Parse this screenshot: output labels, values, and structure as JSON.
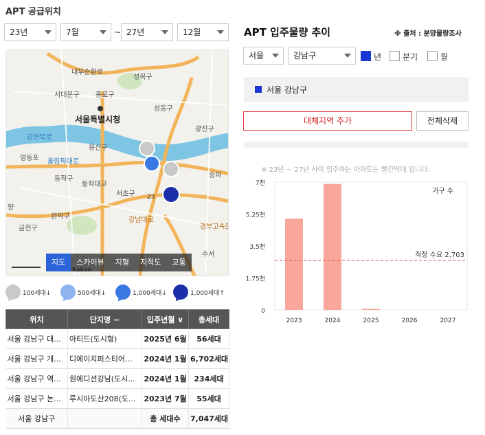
{
  "left": {
    "section_title": "APT 공급위치",
    "filters": {
      "start_year": "23년",
      "start_month": "7월",
      "range_sep": "~",
      "end_year": "27년",
      "end_month": "12월"
    },
    "map": {
      "labels": [
        "서울특별시청",
        "내부순환로",
        "성북구",
        "서대문구",
        "종로구",
        "성동구",
        "광진구",
        "강변북로",
        "올림픽대로",
        "용산구",
        "동작대교",
        "서초구",
        "동작구",
        "영등포",
        "관악구",
        "강남대로",
        "송파",
        "수서",
        "23",
        "경부고속도로",
        "금천구",
        "양",
        "4km",
        "Kakao"
      ],
      "tabs": [
        "지도",
        "스카이뷰",
        "지형",
        "지적도",
        "교통"
      ],
      "active_tab": "지도"
    },
    "legend": [
      {
        "label": "100세대↓",
        "icon": "apt-pin-icon",
        "color": "#c9c9c9"
      },
      {
        "label": "500세대↓",
        "icon": "apt-pin-icon",
        "color": "#8eb3ef"
      },
      {
        "label": "1,000세대↓",
        "icon": "apt-pin-icon",
        "color": "#3a78e2"
      },
      {
        "label": "1,000세대↑",
        "icon": "apt-pin-icon",
        "color": "#1b2fa8"
      }
    ],
    "table": {
      "headers": [
        "위치",
        "단지명 −",
        "입주년월 ∨",
        "총세대"
      ],
      "rows": [
        [
          "서울 강남구 대...",
          "아티드(도시형)",
          "2025년 6월",
          "56세대"
        ],
        [
          "서울 강남구 개...",
          "디에이치퍼스티어...",
          "2024년 1월",
          "6,702세대"
        ],
        [
          "서울 강남구 역...",
          "원에디션강남(도시...",
          "2024년 1월",
          "234세대"
        ],
        [
          "서울 강남구 논...",
          "루시아도산208(도...",
          "2023년 7월",
          "55세대"
        ]
      ],
      "summary": {
        "region": "서울 강남구",
        "label": "총 세대수",
        "total": "7,047세대"
      }
    }
  },
  "right": {
    "title": "APT 입주물량 추이",
    "source": "※ 출처 : 분양물량조사",
    "city": "서울",
    "district": "강남구",
    "period_options": [
      {
        "label": "년",
        "checked": true
      },
      {
        "label": "분기",
        "checked": false
      },
      {
        "label": "월",
        "checked": false
      }
    ],
    "selected_region": "서울 강남구",
    "add_region_label": "대체지역 추가",
    "delete_all_label": "전체삭제",
    "chart_note": "※ 23년 ~ 27년 사이 입주하는 아파트는 빨간막대 입니다.",
    "accent_color": "#1a37d6",
    "bar_color": "#f8a79a",
    "ref_line_color": "#e05050"
  },
  "chart_data": {
    "type": "bar",
    "categories": [
      "2023",
      "2024",
      "2025",
      "2026",
      "2027"
    ],
    "series": [
      {
        "name": "가구 수",
        "values": [
          5000,
          6900,
          60,
          0,
          0
        ]
      }
    ],
    "ylim": [
      0,
      7000
    ],
    "yticks": [
      0,
      1750,
      3500,
      5250,
      7000
    ],
    "ytick_labels": [
      "0",
      "1.75천",
      "3.5천",
      "5.25천",
      "7천"
    ],
    "reference_line": {
      "label": "적정 수요 2,703",
      "value": 2703
    },
    "legend_placement": "top-right",
    "grid": false
  }
}
